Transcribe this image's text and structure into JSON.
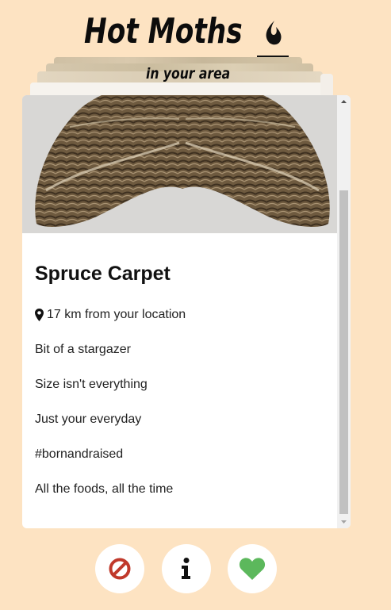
{
  "header": {
    "title": "Hot Moths",
    "subtitle": "in your area",
    "flame_icon": "flame-icon"
  },
  "profile": {
    "name": "Spruce Carpet",
    "location_icon": "map-pin-icon",
    "location": "17 km from your location",
    "bio": [
      "Bit of a stargazer",
      "Size isn't everything",
      "Just your everyday",
      "#bornandraised",
      "All the foods, all the time"
    ]
  },
  "actions": {
    "reject_icon": "prohibited-icon",
    "info_icon": "info-icon",
    "like_icon": "heart-icon"
  },
  "colors": {
    "background": "#fde3c2",
    "card": "#ffffff",
    "reject": "#c0392b",
    "like": "#5cb85c",
    "text": "#111111"
  }
}
